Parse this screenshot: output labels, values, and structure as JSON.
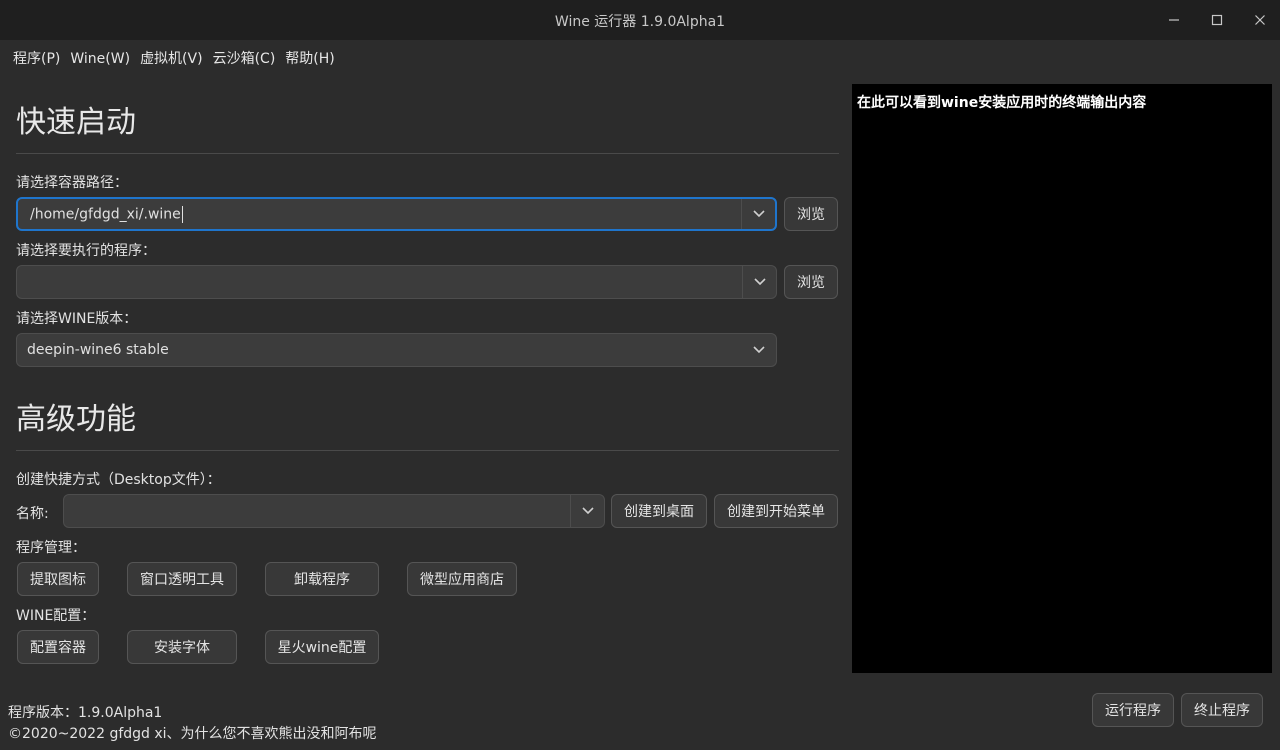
{
  "window": {
    "title": "Wine 运行器 1.9.0Alpha1",
    "minimize_icon": "minimize-icon",
    "maximize_icon": "maximize-icon",
    "close_icon": "close-icon"
  },
  "menu": {
    "items": [
      "程序(P)",
      "Wine(W)",
      "虚拟机(V)",
      "云沙箱(C)",
      "帮助(H)"
    ]
  },
  "quick_start": {
    "heading": "快速启动",
    "container_label": "请选择容器路径：",
    "container_value": "/home/gfdgd_xi/.wine",
    "program_label": "请选择要执行的程序：",
    "program_value": "",
    "wine_label": "请选择WINE版本：",
    "wine_value": "deepin-wine6 stable",
    "browse_label": "浏览"
  },
  "advanced": {
    "heading": "高级功能",
    "shortcut_label": "创建快捷方式（Desktop文件）：",
    "name_label": "名称:",
    "name_value": "",
    "create_desktop": "创建到桌面",
    "create_start_menu": "创建到开始菜单",
    "program_mgmt_label": "程序管理：",
    "program_mgmt_buttons": [
      "提取图标",
      "窗口透明工具",
      "卸载程序",
      "微型应用商店"
    ],
    "wine_config_label": "WINE配置：",
    "wine_config_buttons": [
      "配置容器",
      "安装字体",
      "星火wine配置"
    ]
  },
  "terminal": {
    "text": "在此可以看到wine安装应用时的终端输出内容"
  },
  "footer": {
    "version": "程序版本：1.9.0Alpha1",
    "copyright": "©2020~2022 gfdgd xi、为什么您不喜欢熊出没和阿布呢",
    "run_button": "运行程序",
    "stop_button": "终止程序"
  }
}
